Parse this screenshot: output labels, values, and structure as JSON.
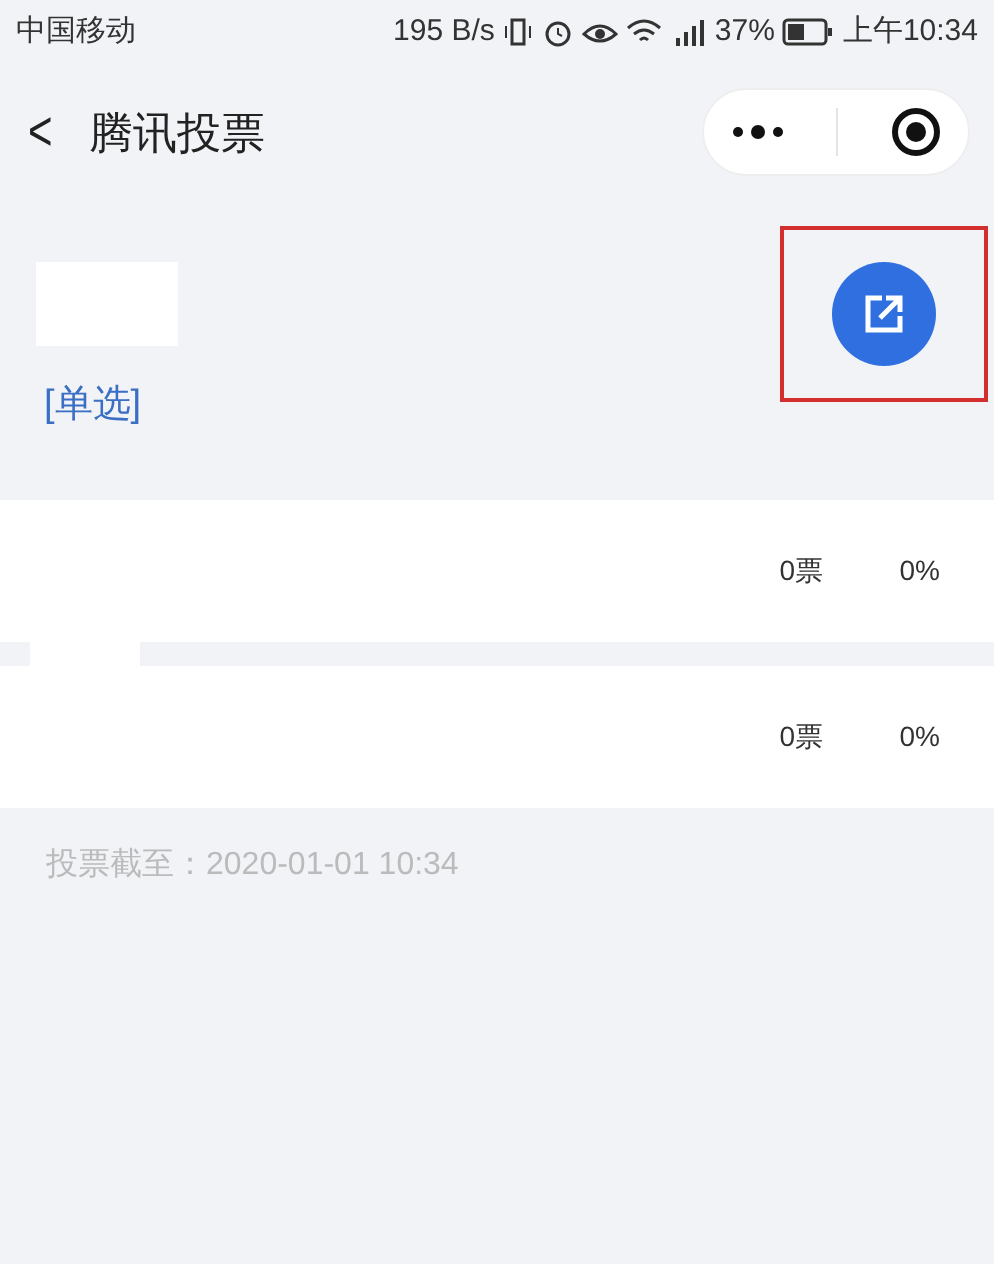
{
  "status_bar": {
    "carrier": "中国移动",
    "speed": "195 B/s",
    "battery": "37%",
    "time": "上午10:34"
  },
  "nav": {
    "back": "<",
    "title": "腾讯投票"
  },
  "poll": {
    "type_label": "[单选]",
    "highlighted_share": true
  },
  "options": [
    {
      "votes": "0票",
      "percent": "0%"
    },
    {
      "votes": "0票",
      "percent": "0%"
    }
  ],
  "deadline": "投票截至：2020-01-01 10:34"
}
